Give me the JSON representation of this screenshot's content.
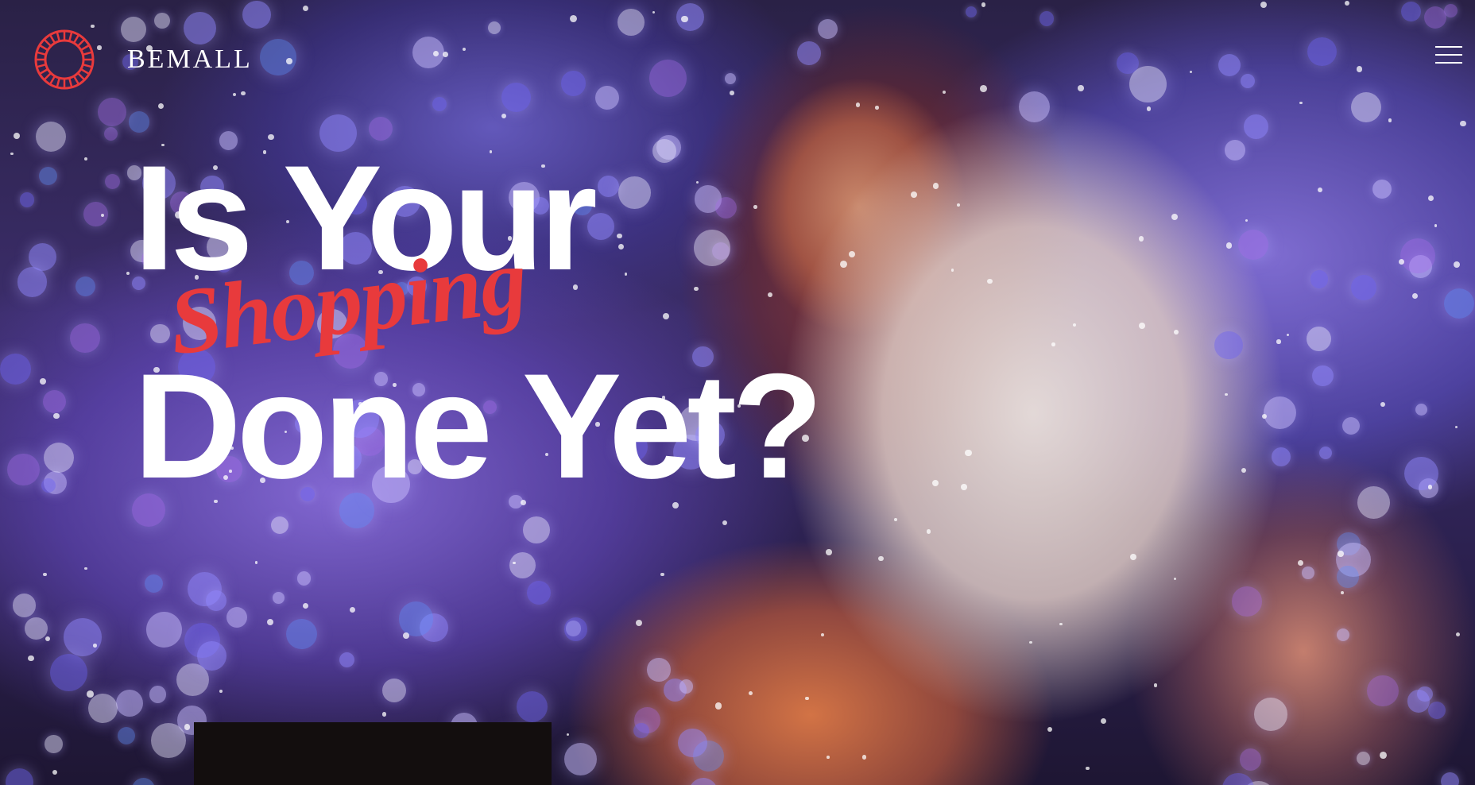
{
  "brand": {
    "name": "BEMALL",
    "logo_icon": "wreath-logo-icon",
    "accent_color": "#e83a3c"
  },
  "nav": {
    "menu_icon": "hamburger-menu-icon"
  },
  "hero": {
    "headline_line1": "Is Your",
    "headline_script": "Shopping",
    "headline_line2": "Done Yet?",
    "background_image": "woman-holding-shopping-bags-in-snow-with-bokeh-lights"
  },
  "colors": {
    "headline": "#ffffff",
    "script": "#e83a3c",
    "cta_block": "#130e0e"
  }
}
